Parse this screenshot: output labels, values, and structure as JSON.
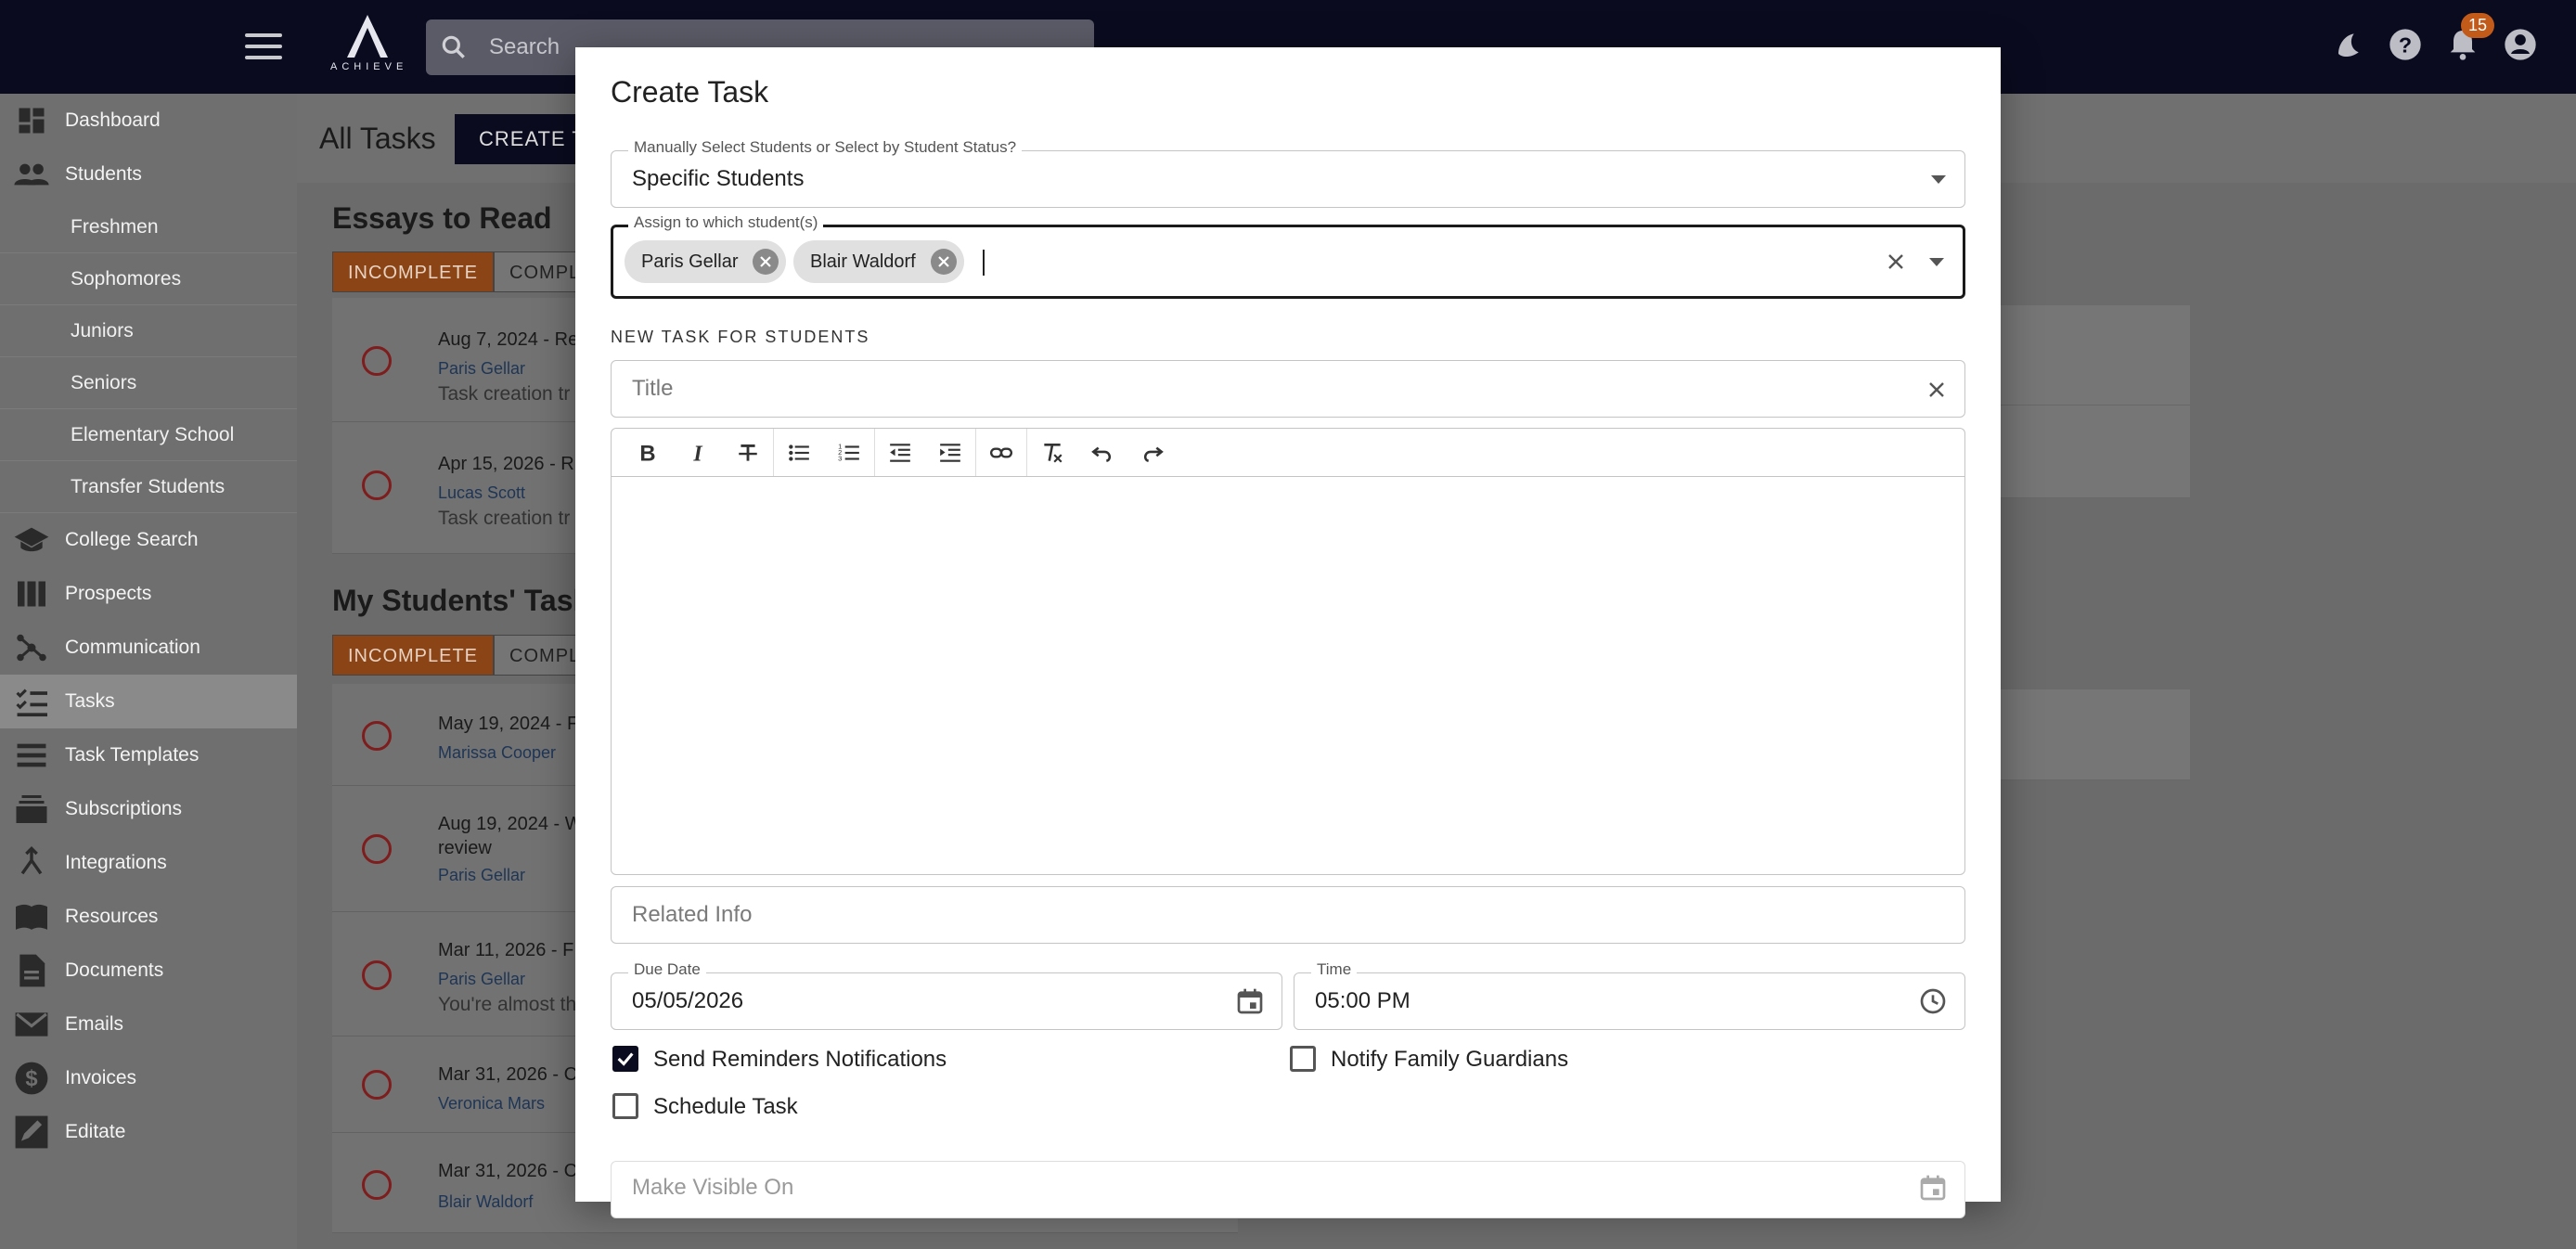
{
  "topbar": {
    "logo_text": "ACHIEVE",
    "search_placeholder": "Search",
    "notifications_count": "15"
  },
  "sidebar": {
    "items": [
      {
        "label": "Dashboard",
        "icon": "dashboard-icon"
      },
      {
        "label": "Students",
        "icon": "people-icon"
      },
      {
        "label": "College Search",
        "icon": "school-icon"
      },
      {
        "label": "Prospects",
        "icon": "columns-icon"
      },
      {
        "label": "Communication",
        "icon": "hub-icon"
      },
      {
        "label": "Tasks",
        "icon": "checklist-icon"
      },
      {
        "label": "Task Templates",
        "icon": "list-icon"
      },
      {
        "label": "Subscriptions",
        "icon": "subscriptions-icon"
      },
      {
        "label": "Integrations",
        "icon": "merge-icon"
      },
      {
        "label": "Resources",
        "icon": "book-icon"
      },
      {
        "label": "Documents",
        "icon": "document-icon"
      },
      {
        "label": "Emails",
        "icon": "mail-icon"
      },
      {
        "label": "Invoices",
        "icon": "dollar-icon"
      },
      {
        "label": "Editate",
        "icon": "edit-icon"
      }
    ],
    "students_sub": [
      "Freshmen",
      "Sophomores",
      "Juniors",
      "Seniors",
      "Elementary School",
      "Transfer Students"
    ]
  },
  "main": {
    "title": "All Tasks",
    "create_btn": "CREATE TA",
    "essays_title": "Essays to Read",
    "students_tasks_title": "My Students' Tasks",
    "tab_incomplete": "INCOMPLETE",
    "tab_complete": "COMPLET",
    "essays": [
      {
        "title": "Aug 7, 2024 - Re",
        "student": "Paris Gellar",
        "desc": "Task creation tr"
      },
      {
        "title": "Apr 15, 2026 - R",
        "student": "Lucas Scott",
        "desc": "Task creation tr"
      }
    ],
    "tasks": [
      {
        "title": "May 19, 2024 - F",
        "student": "Marissa Cooper",
        "desc": ""
      },
      {
        "title": "Aug 19, 2024 - W",
        "title2": "review",
        "student": "Paris Gellar",
        "desc": ""
      },
      {
        "title": "Mar 11, 2026 - F",
        "student": "Paris Gellar",
        "desc": "You're almost th"
      },
      {
        "title": "Mar 31, 2026 - C",
        "student": "Veronica Mars",
        "desc": ""
      },
      {
        "title": "Mar 31, 2026 - C",
        "student": "Blair Waldorf",
        "desc": ""
      }
    ]
  },
  "modal": {
    "title": "Create Task",
    "select_mode_label": "Manually Select Students or Select by Student Status?",
    "select_mode_value": "Specific Students",
    "assign_label": "Assign to which student(s)",
    "chips": [
      "Paris Gellar",
      "Blair Waldorf"
    ],
    "section_label": "NEW TASK FOR STUDENTS",
    "title_placeholder": "Title",
    "related_placeholder": "Related Info",
    "due_label": "Due Date",
    "due_value": "05/05/2026",
    "time_label": "Time",
    "time_value": "05:00 PM",
    "send_reminders": "Send Reminders Notifications",
    "notify_guardians": "Notify Family Guardians",
    "schedule_task": "Schedule Task",
    "visible_placeholder": "Make Visible On"
  }
}
